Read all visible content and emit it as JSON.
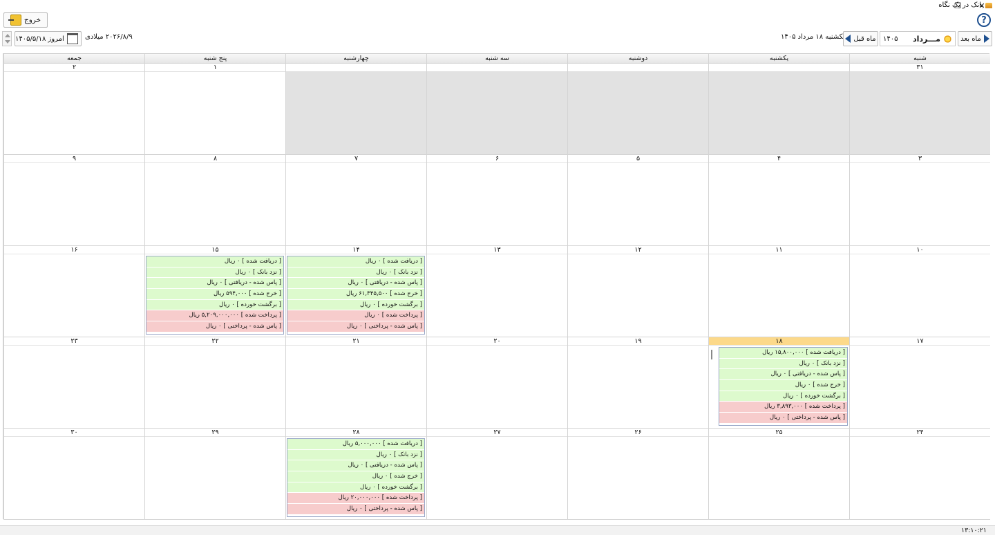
{
  "window": {
    "title": "بانک در یک نگاه",
    "restore_glyph": "❐",
    "close_glyph": "✕"
  },
  "toolbar": {
    "help_label": "?",
    "exit_label": "خروج",
    "today_label": "امروز ۱۴۰۵/۵/۱۸",
    "gregorian_label": "۲۰۲۶/۸/۹ میلادی",
    "prev_month_label": "ماه قبل",
    "next_month_label": "ماه بعد",
    "month_name": "مـــرداد",
    "year": "۱۴۰۵",
    "current_date_label": "یکشنبه ۱۸ مرداد ۱۴۰۵"
  },
  "weekdays": [
    "شنبه",
    "یکشنبه",
    "دوشنبه",
    "سه شنبه",
    "چهارشنبه",
    "پنج شنبه",
    "جمعه"
  ],
  "weeks": [
    [
      {
        "d": "۳۱",
        "out": true
      },
      {
        "d": "",
        "out": true
      },
      {
        "d": "",
        "out": true
      },
      {
        "d": "",
        "out": true
      },
      {
        "d": "",
        "out": true
      },
      {
        "d": "۱"
      },
      {
        "d": "۲"
      }
    ],
    [
      {
        "d": "۳"
      },
      {
        "d": "۴"
      },
      {
        "d": "۵"
      },
      {
        "d": "۶"
      },
      {
        "d": "۷"
      },
      {
        "d": "۸"
      },
      {
        "d": "۹"
      }
    ],
    [
      {
        "d": "۱۰"
      },
      {
        "d": "۱۱"
      },
      {
        "d": "۱۲"
      },
      {
        "d": "۱۳"
      },
      {
        "d": "۱۴",
        "ev": "d14"
      },
      {
        "d": "۱۵",
        "ev": "d15"
      },
      {
        "d": "۱۶"
      }
    ],
    [
      {
        "d": "۱۷"
      },
      {
        "d": "۱۸",
        "ev": "d18",
        "today": true
      },
      {
        "d": "۱۹"
      },
      {
        "d": "۲۰"
      },
      {
        "d": "۲۱"
      },
      {
        "d": "۲۲"
      },
      {
        "d": "۲۳"
      }
    ],
    [
      {
        "d": "۲۴"
      },
      {
        "d": "۲۵"
      },
      {
        "d": "۲۶"
      },
      {
        "d": "۲۷"
      },
      {
        "d": "۲۸",
        "ev": "d28"
      },
      {
        "d": "۲۹"
      },
      {
        "d": "۳۰"
      }
    ]
  ],
  "events": {
    "d14": [
      {
        "text": "[ دریافت شده ] ۰ ریال",
        "type": "green"
      },
      {
        "text": "[ نزد بانک ] ۰ ریال",
        "type": "green"
      },
      {
        "text": "[ پاس شده - دریافتی ] ۰ ریال",
        "type": "green"
      },
      {
        "text": "[ خرج شده ] ۶۱,۳۴۵,۵۰۰ ریال",
        "type": "green"
      },
      {
        "text": "[ برگشت خورده ] ۰ ریال",
        "type": "green"
      },
      {
        "text": "[ پرداخت شده ] ۰ ریال",
        "type": "red"
      },
      {
        "text": "[ پاس شده - پرداختی ] ۰ ریال",
        "type": "red"
      }
    ],
    "d15": [
      {
        "text": "[ دریافت شده ] ۰ ریال",
        "type": "green"
      },
      {
        "text": "[ نزد بانک ] ۰ ریال",
        "type": "green"
      },
      {
        "text": "[ پاس شده - دریافتی ] ۰ ریال",
        "type": "green"
      },
      {
        "text": "[ خرج شده ] ۵۹۴,۰۰۰ ریال",
        "type": "green"
      },
      {
        "text": "[ برگشت خورده ] ۰ ریال",
        "type": "green"
      },
      {
        "text": "[ پرداخت شده ] ۵,۲۰۹,۰۰۰,۰۰۰ ریال",
        "type": "red"
      },
      {
        "text": "[ پاس شده - پرداختی ] ۰ ریال",
        "type": "red"
      }
    ],
    "d18": [
      {
        "text": "[ دریافت شده ] ۱۵,۸۰۰,۰۰۰ ریال",
        "type": "green"
      },
      {
        "text": "[ نزد بانک ] ۰ ریال",
        "type": "green"
      },
      {
        "text": "[ پاس شده - دریافتی ] ۰ ریال",
        "type": "green"
      },
      {
        "text": "[ خرج شده ] ۰ ریال",
        "type": "green"
      },
      {
        "text": "[ برگشت خورده ] ۰ ریال",
        "type": "green"
      },
      {
        "text": "[ پرداخت شده ] ۳,۸۹۳,۰۰۰ ریال",
        "type": "red"
      },
      {
        "text": "[ پاس شده - پرداختی ] ۰ ریال",
        "type": "red"
      }
    ],
    "d28": [
      {
        "text": "[ دریافت شده ] ۵,۰۰۰,۰۰۰ ریال",
        "type": "green"
      },
      {
        "text": "[ نزد بانک ] ۰ ریال",
        "type": "green"
      },
      {
        "text": "[ پاس شده - دریافتی ] ۰ ریال",
        "type": "green"
      },
      {
        "text": "[ خرج شده ] ۰ ریال",
        "type": "green"
      },
      {
        "text": "[ برگشت خورده ] ۰ ریال",
        "type": "green"
      },
      {
        "text": "[ پرداخت شده ] ۲۰,۰۰۰,۰۰۰ ریال",
        "type": "red"
      },
      {
        "text": "[ پاس شده - پرداختی ] ۰ ریال",
        "type": "red"
      }
    ]
  },
  "colors": {
    "income": "#ddfacd",
    "expense": "#f7cccc",
    "today": "#fcd98a",
    "outside": "#e2e2e2",
    "accent": "#1d4f8f"
  },
  "status": {
    "clock": "۱۳:۱۰:۲۱"
  }
}
